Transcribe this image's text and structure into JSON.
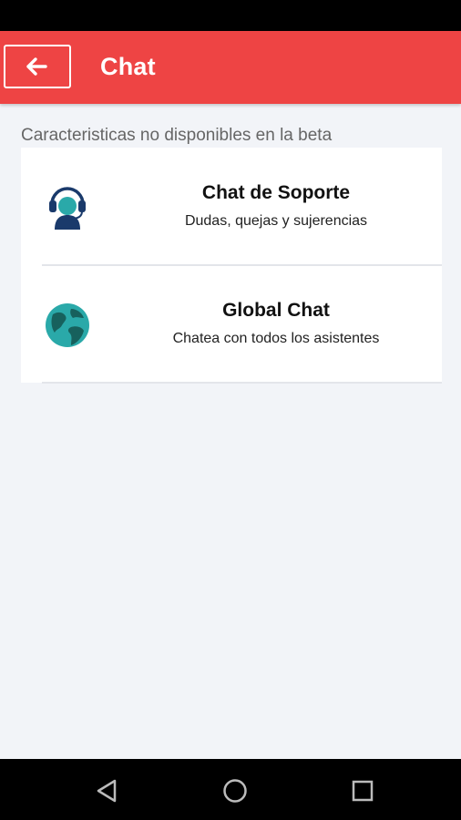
{
  "app_bar": {
    "title": "Chat",
    "back_icon": "arrow-left-icon",
    "color": "#ee4444"
  },
  "section_label": "Caracteristicas no disponibles en la beta",
  "items": [
    {
      "title": "Chat de Soporte",
      "subtitle": "Dudas, quejas y sujerencias",
      "icon": "support-agent-icon"
    },
    {
      "title": "Global Chat",
      "subtitle": "Chatea con todos los asistentes",
      "icon": "globe-icon"
    }
  ],
  "nav_bar": {
    "icons": [
      "back-triangle-icon",
      "home-circle-icon",
      "recents-square-icon"
    ]
  }
}
